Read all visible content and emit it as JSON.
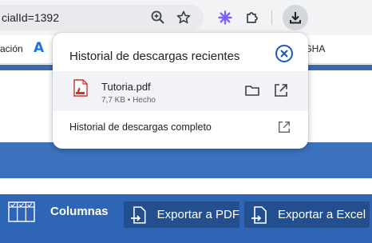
{
  "browser": {
    "url_fragment": "cialId=1392",
    "bookmarks": {
      "item1": "ación",
      "item2_icon": "A",
      "item3": "SIGHA"
    }
  },
  "page": {
    "columns_label": "Columnas",
    "export_pdf_label": "Exportar a PDF",
    "export_excel_label": "Exportar a Excel"
  },
  "downloads_popup": {
    "title": "Historial de descargas recientes",
    "items": [
      {
        "file_name": "Tutoria.pdf",
        "meta": "7,7 KB • Hecho",
        "icon": "pdf-file-icon"
      }
    ],
    "full_history_label": "Historial de descargas completo"
  },
  "colors": {
    "accent": "#1a56c4",
    "page_bar": "#2f65b5",
    "export_button": "#244f8e",
    "extension_icon": "#7b61ff"
  }
}
